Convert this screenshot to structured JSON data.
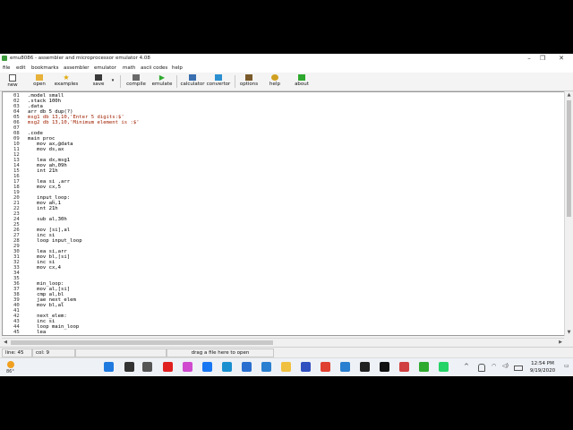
{
  "window": {
    "title": "emu8086 - assembler and microprocessor emulator 4.08"
  },
  "menu": [
    "file",
    "edit",
    "bookmarks",
    "assembler",
    "emulator",
    "math",
    "ascii codes",
    "help"
  ],
  "toolbar": [
    {
      "label": "new",
      "icon": "new-file-icon",
      "color": "#ffffff"
    },
    {
      "label": "open",
      "icon": "open-folder-icon",
      "color": "#e8b23a"
    },
    {
      "label": "examples",
      "icon": "star-icon",
      "color": "#f0c020"
    },
    {
      "label": "save",
      "icon": "save-disk-icon",
      "color": "#3b3b3b"
    },
    {
      "label": "compile",
      "icon": "compile-icon",
      "color": "#5a5a5a"
    },
    {
      "label": "emulate",
      "icon": "play-icon",
      "color": "#2eaa2e"
    },
    {
      "label": "calculator",
      "icon": "calculator-icon",
      "color": "#3a6fb0"
    },
    {
      "label": "convertor",
      "icon": "convertor-icon",
      "color": "#2b8fd0"
    },
    {
      "label": "options",
      "icon": "options-icon",
      "color": "#7a5a2a"
    },
    {
      "label": "help",
      "icon": "help-icon",
      "color": "#d0a020"
    },
    {
      "label": "about",
      "icon": "about-icon",
      "color": "#2ea82e"
    }
  ],
  "code_lines": [
    {
      "n": "01",
      "t": ".model small"
    },
    {
      "n": "02",
      "t": ".stack 100h"
    },
    {
      "n": "03",
      "t": ".data"
    },
    {
      "n": "04",
      "t": "arr db 5 dup(?)"
    },
    {
      "n": "05",
      "t": "msg1 db 13,10,'Enter 5 digits:$'"
    },
    {
      "n": "06",
      "t": "msg2 db 13,10,'Minimum element is :$'"
    },
    {
      "n": "07",
      "t": ""
    },
    {
      "n": "08",
      "t": ".code"
    },
    {
      "n": "09",
      "t": "main proc"
    },
    {
      "n": "10",
      "t": "   mov ax,@data"
    },
    {
      "n": "11",
      "t": "   mov ds,ax"
    },
    {
      "n": "12",
      "t": ""
    },
    {
      "n": "13",
      "t": "   lea dx,msg1"
    },
    {
      "n": "14",
      "t": "   mov ah,09h"
    },
    {
      "n": "15",
      "t": "   int 21h"
    },
    {
      "n": "16",
      "t": ""
    },
    {
      "n": "17",
      "t": "   lea si ,arr"
    },
    {
      "n": "18",
      "t": "   mov cx,5"
    },
    {
      "n": "19",
      "t": ""
    },
    {
      "n": "20",
      "t": "   input_loop:"
    },
    {
      "n": "21",
      "t": "   mov ah,1"
    },
    {
      "n": "22",
      "t": "   int 21h"
    },
    {
      "n": "23",
      "t": ""
    },
    {
      "n": "24",
      "t": "   sub al,30h"
    },
    {
      "n": "25",
      "t": ""
    },
    {
      "n": "26",
      "t": "   mov [si],al"
    },
    {
      "n": "27",
      "t": "   inc si"
    },
    {
      "n": "28",
      "t": "   loop input_loop"
    },
    {
      "n": "29",
      "t": ""
    },
    {
      "n": "30",
      "t": "   lea si,arr"
    },
    {
      "n": "31",
      "t": "   mov bl,[si]"
    },
    {
      "n": "32",
      "t": "   inc si"
    },
    {
      "n": "33",
      "t": "   mov cx,4"
    },
    {
      "n": "34",
      "t": ""
    },
    {
      "n": "35",
      "t": ""
    },
    {
      "n": "36",
      "t": "   min_loop:"
    },
    {
      "n": "37",
      "t": "   mov al,[si]"
    },
    {
      "n": "38",
      "t": "   cmp al,bl"
    },
    {
      "n": "39",
      "t": "   jae next_elem"
    },
    {
      "n": "40",
      "t": "   mov bl,al"
    },
    {
      "n": "41",
      "t": ""
    },
    {
      "n": "42",
      "t": "   next_elem:"
    },
    {
      "n": "43",
      "t": "   inc si"
    },
    {
      "n": "44",
      "t": "   loop main_loop"
    },
    {
      "n": "45",
      "t": "   lea"
    }
  ],
  "status": {
    "line": "line: 45",
    "col": "col: 9",
    "hint": "drag a file here to open"
  },
  "taskbar": {
    "weather_temp": "86°",
    "weather_icon": "sun-icon",
    "icons": [
      {
        "name": "windows-start-icon",
        "color": "#1f7ae0"
      },
      {
        "name": "search-icon",
        "color": "#333333"
      },
      {
        "name": "task-view-icon",
        "color": "#555555"
      },
      {
        "name": "youtube-icon",
        "color": "#e02020"
      },
      {
        "name": "photos-icon",
        "color": "#d04ad0"
      },
      {
        "name": "facebook-icon",
        "color": "#1877f2"
      },
      {
        "name": "edge-icon",
        "color": "#1a8fd0"
      },
      {
        "name": "mail-icon",
        "color": "#2a6fd0"
      },
      {
        "name": "store-icon",
        "color": "#2a7fd0"
      },
      {
        "name": "file-explorer-icon",
        "color": "#f0c040"
      },
      {
        "name": "app-icon",
        "color": "#3050c0"
      },
      {
        "name": "chrome-icon",
        "color": "#e04030"
      },
      {
        "name": "image-app-icon",
        "color": "#2a7fd0"
      },
      {
        "name": "app-dark-icon",
        "color": "#222222"
      },
      {
        "name": "capcut-icon",
        "color": "#111111"
      },
      {
        "name": "snip-icon",
        "color": "#d04040"
      },
      {
        "name": "teams-icon",
        "color": "#4060c0"
      },
      {
        "name": "whatsapp-icon",
        "color": "#25d366"
      },
      {
        "name": "emu8086-icon",
        "color": "#2eaa2e"
      }
    ],
    "time": "12:54 PM",
    "date": "9/19/2020"
  }
}
